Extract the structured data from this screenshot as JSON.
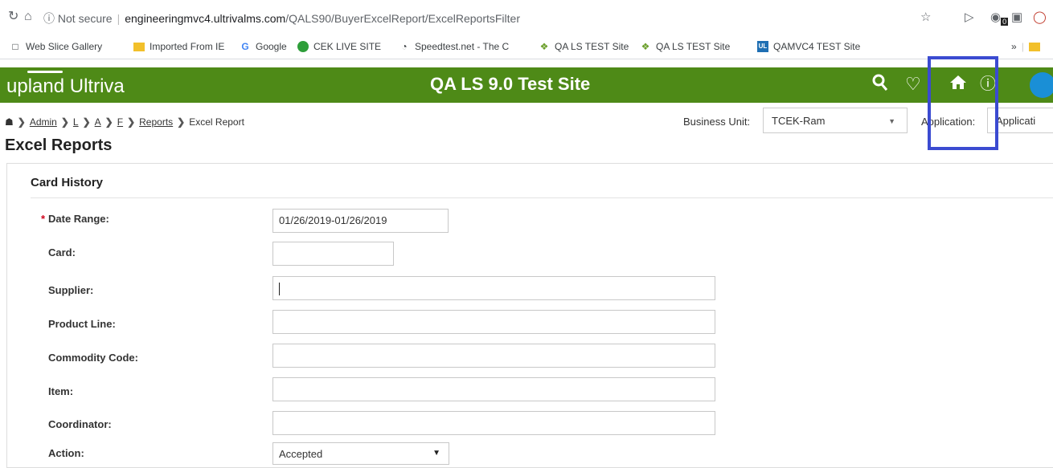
{
  "browser": {
    "insecure_label": "Not secure",
    "host": "engineeringmvc4.ultrivalms.com",
    "path": "/QALS90/BuyerExcelReport/ExcelReportsFilter",
    "ext_badge": "0"
  },
  "bookmarks": [
    {
      "label": "Web Slice Gallery",
      "icon": "page-icon"
    },
    {
      "label": "Imported From IE",
      "icon": "folder-icon"
    },
    {
      "label": "Google",
      "icon": "google-icon"
    },
    {
      "label": "CEK LIVE SITE",
      "icon": "cek-icon"
    },
    {
      "label": "Speedtest.net - The C",
      "icon": "gauge-icon"
    },
    {
      "label": "QA LS TEST Site",
      "icon": "diamond-icon"
    },
    {
      "label": "QA LS TEST Site",
      "icon": "diamond-icon"
    },
    {
      "label": "QAMVC4 TEST Site",
      "icon": "ul-icon"
    }
  ],
  "bookmarks_more": "»",
  "header": {
    "logo": "upland Ultriva",
    "site_title": "QA LS 9.0 Test Site",
    "brand_color": "#4e8a17"
  },
  "breadcrumb": {
    "items": [
      "Admin",
      "Reports",
      "Excel Report"
    ]
  },
  "page_title": "Excel Reports",
  "business_unit": {
    "label": "Business Unit:",
    "value": "TCEK-Ram"
  },
  "application": {
    "label": "Application:",
    "value": "Applicati"
  },
  "card": {
    "title": "Card History",
    "fields": [
      {
        "label": "Date Range:",
        "value": "01/26/2019-01/26/2019",
        "required": true
      },
      {
        "label": "Card:",
        "value": ""
      },
      {
        "label": "Supplier:",
        "value": ""
      },
      {
        "label": "Product Line:",
        "value": ""
      },
      {
        "label": "Commodity Code:",
        "value": ""
      },
      {
        "label": "Item:",
        "value": ""
      },
      {
        "label": "Coordinator:",
        "value": ""
      },
      {
        "label": "Action:",
        "value": "Accepted"
      }
    ]
  },
  "highlight_color": "#3b4bd1"
}
